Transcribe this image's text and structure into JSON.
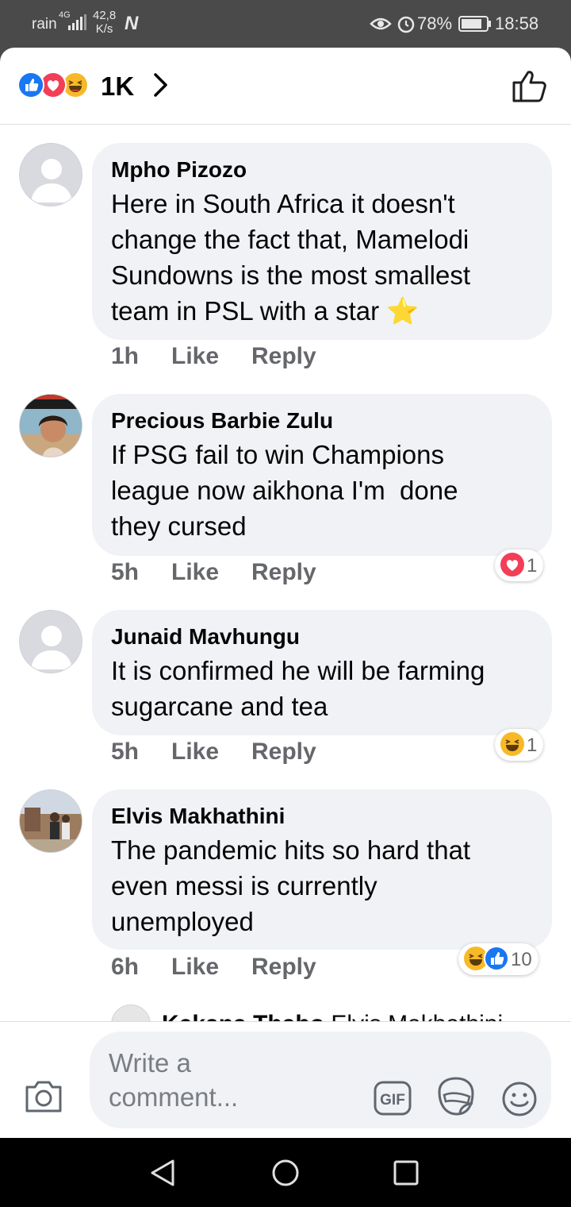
{
  "status_bar": {
    "carrier": "rain",
    "network_type": "4G",
    "network_speed_value": "42,8",
    "network_speed_unit": "K/s",
    "battery_percent": "78%",
    "time": "18:58"
  },
  "header": {
    "reaction_icons": [
      "like-reaction-icon",
      "love-reaction-icon",
      "haha-reaction-icon"
    ],
    "reaction_count": "1K"
  },
  "comments": [
    {
      "name": "Mpho Pizozo",
      "lines": [
        "Here in South Africa it doesn't",
        "change the fact that, Mamelodi",
        "Sundowns is the most smallest",
        "team in PSL with a star"
      ],
      "emoji": "⭐",
      "time": "1h",
      "like_label": "Like",
      "reply_label": "Reply",
      "reaction_count": null
    },
    {
      "name": "Precious Barbie Zulu",
      "lines": [
        "If PSG fail to win Champions",
        "league now aikhona I'm  done",
        "they cursed"
      ],
      "time": "5h",
      "like_label": "Like",
      "reply_label": "Reply",
      "reaction_count": "1"
    },
    {
      "name": "Junaid Mavhungu",
      "lines": [
        "It is confirmed he will be farming",
        "sugarcane and tea"
      ],
      "time": "5h",
      "like_label": "Like",
      "reply_label": "Reply",
      "reaction_count": "1"
    },
    {
      "name": "Elvis Makhathini",
      "lines": [
        "The pandemic hits so hard that",
        "even messi is currently",
        "unemployed"
      ],
      "time": "6h",
      "like_label": "Like",
      "reply_label": "Reply",
      "reaction_count": "10"
    }
  ],
  "partial_reply": {
    "name": "Kekana Thabo",
    "mention": "Elvis Makhathini"
  },
  "composer": {
    "placeholder_line1": "Write a",
    "placeholder_line2": "comment...",
    "gif_label": "GIF"
  },
  "colors": {
    "like_blue": "#1877f2",
    "love_red": "#f33e58",
    "haha_yellow": "#f7b928",
    "bubble_grey": "#f0f2f5",
    "meta_grey": "#65676b"
  }
}
